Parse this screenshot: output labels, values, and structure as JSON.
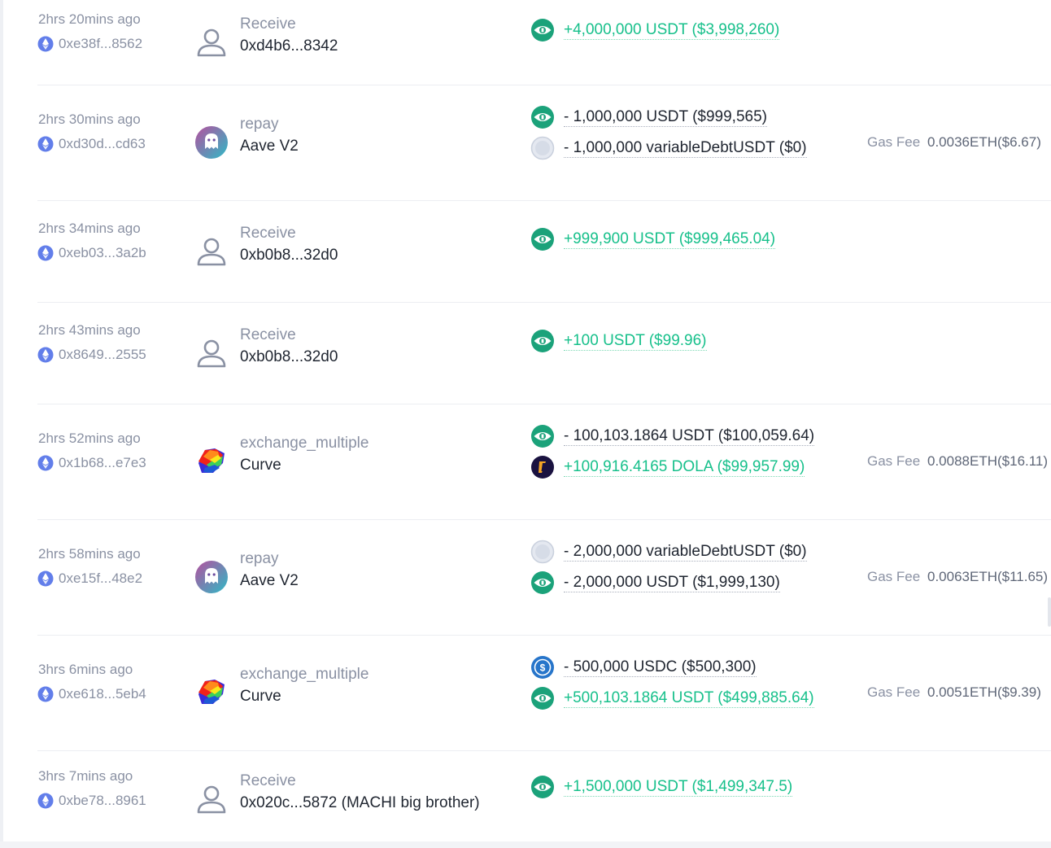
{
  "colors": {
    "positive": "#17c08b",
    "text": "#1f2530",
    "muted": "#8a91a3",
    "usdt": "#1ba27a",
    "dola": "#1a1240",
    "usdc": "#2775ca"
  },
  "gas_label": "Gas Fee",
  "transactions": [
    {
      "time": "2hrs 20mins ago",
      "hash": "0xe38f...8562",
      "kind": "Receive",
      "party": "0xd4b6...8342",
      "avatar": "user-icon",
      "tokens": [
        {
          "icon": "usdt",
          "text": "+4,000,000 USDT ($3,998,260)",
          "dir": "in"
        }
      ],
      "gas": ""
    },
    {
      "time": "2hrs 30mins ago",
      "hash": "0xd30d...cd63",
      "kind": "repay",
      "party": "Aave V2",
      "avatar": "aave-logo",
      "tokens": [
        {
          "icon": "usdt",
          "text": "- 1,000,000 USDT ($999,565)",
          "dir": "out"
        },
        {
          "icon": "debt",
          "text": "- 1,000,000 variableDebtUSDT ($0)",
          "dir": "out"
        }
      ],
      "gas": "0.0036ETH($6.67)"
    },
    {
      "time": "2hrs 34mins ago",
      "hash": "0xeb03...3a2b",
      "kind": "Receive",
      "party": "0xb0b8...32d0",
      "avatar": "user-icon",
      "tokens": [
        {
          "icon": "usdt",
          "text": "+999,900 USDT ($999,465.04)",
          "dir": "in"
        }
      ],
      "gas": ""
    },
    {
      "time": "2hrs 43mins ago",
      "hash": "0x8649...2555",
      "kind": "Receive",
      "party": "0xb0b8...32d0",
      "avatar": "user-icon",
      "tokens": [
        {
          "icon": "usdt",
          "text": "+100 USDT ($99.96)",
          "dir": "in"
        }
      ],
      "gas": ""
    },
    {
      "time": "2hrs 52mins ago",
      "hash": "0x1b68...e7e3",
      "kind": "exchange_multiple",
      "party": "Curve",
      "avatar": "curve-logo",
      "tokens": [
        {
          "icon": "usdt",
          "text": "- 100,103.1864 USDT ($100,059.64)",
          "dir": "out"
        },
        {
          "icon": "dola",
          "text": "+100,916.4165 DOLA ($99,957.99)",
          "dir": "in"
        }
      ],
      "gas": "0.0088ETH($16.11)"
    },
    {
      "time": "2hrs 58mins ago",
      "hash": "0xe15f...48e2",
      "kind": "repay",
      "party": "Aave V2",
      "avatar": "aave-logo",
      "tokens": [
        {
          "icon": "debt",
          "text": "- 2,000,000 variableDebtUSDT ($0)",
          "dir": "out"
        },
        {
          "icon": "usdt",
          "text": "- 2,000,000 USDT ($1,999,130)",
          "dir": "out"
        }
      ],
      "gas": "0.0063ETH($11.65)"
    },
    {
      "time": "3hrs 6mins ago",
      "hash": "0xe618...5eb4",
      "kind": "exchange_multiple",
      "party": "Curve",
      "avatar": "curve-logo",
      "tokens": [
        {
          "icon": "usdc",
          "text": "- 500,000 USDC ($500,300)",
          "dir": "out"
        },
        {
          "icon": "usdt",
          "text": "+500,103.1864 USDT ($499,885.64)",
          "dir": "in"
        }
      ],
      "gas": "0.0051ETH($9.39)"
    },
    {
      "time": "3hrs 7mins ago",
      "hash": "0xbe78...8961",
      "kind": "Receive",
      "party": "0x020c...5872 (MACHI big brother)",
      "avatar": "user-icon",
      "tokens": [
        {
          "icon": "usdt",
          "text": "+1,500,000 USDT ($1,499,347.5)",
          "dir": "in"
        }
      ],
      "gas": ""
    }
  ]
}
